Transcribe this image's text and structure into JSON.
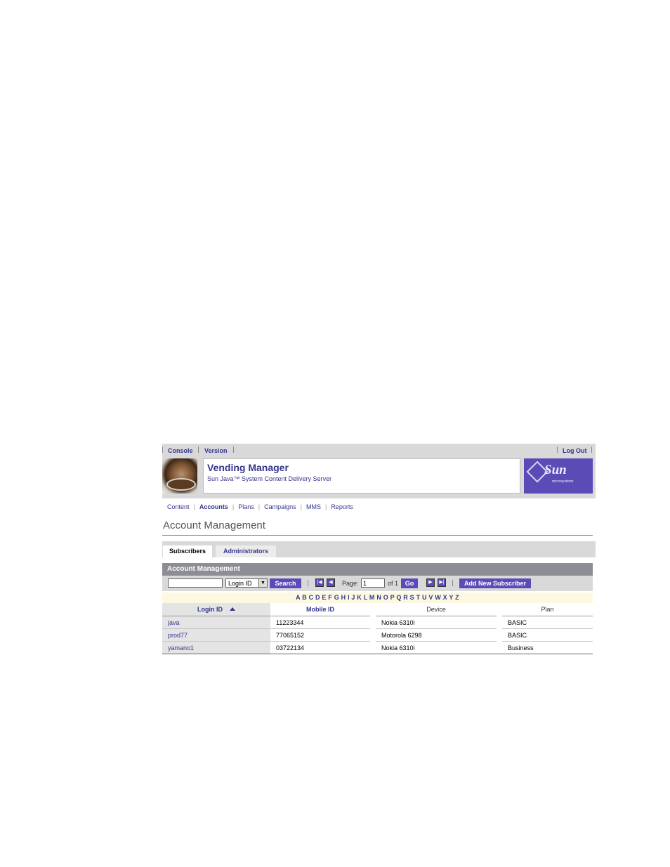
{
  "masthead": {
    "links": [
      "Console",
      "Version"
    ],
    "logout": "Log Out",
    "app_title": "Vending Manager",
    "app_subtitle": "Sun Java™ System Content Delivery Server",
    "logo_text": "Sun",
    "logo_subtext": "microsystems"
  },
  "nav": {
    "items": [
      "Content",
      "Accounts",
      "Plans",
      "Campaigns",
      "MMS",
      "Reports"
    ],
    "selected": "Accounts"
  },
  "page_title": "Account Management",
  "tabs": [
    "Subscribers",
    "Administrators"
  ],
  "panel": {
    "title": "Account Management",
    "search_value": "",
    "search_field": "Login ID",
    "search_button": "Search",
    "page_label": "Page:",
    "page_value": "1",
    "page_of": "of 1",
    "go_button": "Go",
    "add_button": "Add New Subscriber",
    "alphabet": "A B C D E F G H I J K L M N O P Q R S T U V W X Y Z"
  },
  "table": {
    "headers": [
      "Login ID",
      "Mobile ID",
      "Device",
      "Plan"
    ],
    "rows": [
      [
        "java",
        "11223344",
        "Nokia 6310i",
        "BASIC"
      ],
      [
        "prod77",
        "77065152",
        "Motorola 6298",
        "BASIC"
      ],
      [
        "yamano1",
        "03722134",
        "Nokia 6310i",
        "Business"
      ]
    ]
  },
  "colors": {
    "accent": "#5b4bb7",
    "link": "#35358c",
    "chrome": "#d9d9d9"
  }
}
